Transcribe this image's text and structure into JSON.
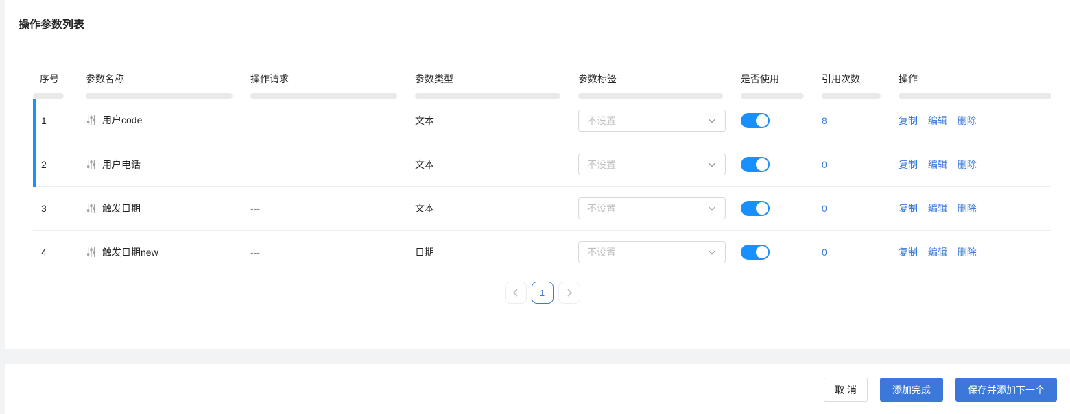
{
  "page": {
    "title": "操作参数列表"
  },
  "table": {
    "columns": [
      "序号",
      "参数名称",
      "操作请求",
      "参数类型",
      "参数标签",
      "是否使用",
      "引用次数",
      "操作"
    ],
    "rows": [
      {
        "index": "1",
        "name": "用户code",
        "request": "",
        "type": "文本",
        "label_placeholder": "不设置",
        "enabled": true,
        "ref_count": "8",
        "highlighted": true
      },
      {
        "index": "2",
        "name": "用户电话",
        "request": "",
        "type": "文本",
        "label_placeholder": "不设置",
        "enabled": true,
        "ref_count": "0",
        "highlighted": true
      },
      {
        "index": "3",
        "name": "触发日期",
        "request": "---",
        "type": "文本",
        "label_placeholder": "不设置",
        "enabled": true,
        "ref_count": "0",
        "highlighted": false
      },
      {
        "index": "4",
        "name": "触发日期new",
        "request": "---",
        "type": "日期",
        "label_placeholder": "不设置",
        "enabled": true,
        "ref_count": "0",
        "highlighted": false
      }
    ],
    "actions": {
      "copy": "复制",
      "edit": "编辑",
      "delete": "删除"
    }
  },
  "pagination": {
    "current": "1"
  },
  "footer": {
    "cancel": "取 消",
    "add_done": "添加完成",
    "save_next": "保存并添加下一个"
  },
  "colors": {
    "accent_blue": "#3b78da",
    "link_blue": "#3b7ad9",
    "toggle_blue": "#1890ff",
    "row_highlight_blue": "#1890ff",
    "skeleton_bar_gray": "#e9e9e9"
  }
}
